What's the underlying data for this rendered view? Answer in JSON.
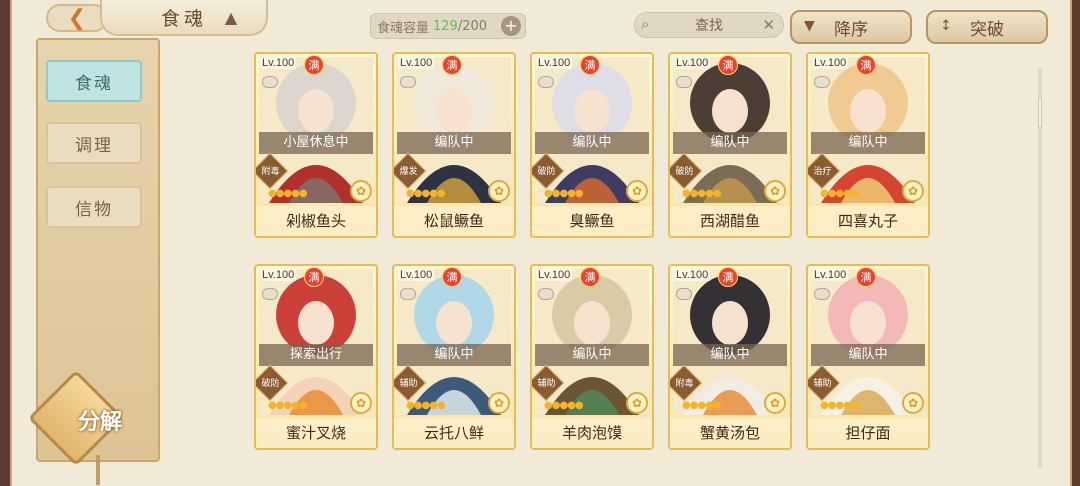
{
  "header": {
    "back_icon": "back-arrow-icon",
    "title": "食魂",
    "capacity_label": "食魂容量",
    "capacity_current": "129",
    "capacity_max": "/200",
    "plus_icon": "plus-icon",
    "search_placeholder": "查找",
    "sort_label": "降序",
    "breakthrough_label": "突破"
  },
  "sidebar": {
    "items": [
      {
        "label": "食魂",
        "active": true
      },
      {
        "label": "调理",
        "active": false
      },
      {
        "label": "信物",
        "active": false
      }
    ],
    "decompose_label": "分解"
  },
  "cards": [
    {
      "level": "Lv.100",
      "badge": "满",
      "status": "小屋休息中",
      "role": "附毒",
      "name": "剁椒鱼头",
      "rarity_color": "#e7bb55",
      "portrait_colors": [
        "#d9d4cf",
        "#b2302c",
        "#7b7672"
      ]
    },
    {
      "level": "Lv.100",
      "badge": "满",
      "status": "编队中",
      "role": "爆发",
      "name": "松鼠鳜鱼",
      "rarity_color": "#e7bb55",
      "portrait_colors": [
        "#efe8dd",
        "#2b3345",
        "#d7a53c"
      ]
    },
    {
      "level": "Lv.100",
      "badge": "满",
      "status": "编队中",
      "role": "破防",
      "name": "臭鳜鱼",
      "rarity_color": "#e7bb55",
      "portrait_colors": [
        "#dddbe8",
        "#3f3c63",
        "#d96a2d"
      ]
    },
    {
      "level": "Lv.100",
      "badge": "满",
      "status": "编队中",
      "role": "破防",
      "name": "西湖醋鱼",
      "rarity_color": "#e7bb55",
      "portrait_colors": [
        "#3a2b23",
        "#7a6c55",
        "#c79a4e"
      ]
    },
    {
      "level": "Lv.100",
      "badge": "满",
      "status": "编队中",
      "role": "治疗",
      "name": "四喜丸子",
      "rarity_color": "#e7bb55",
      "portrait_colors": [
        "#f0c68a",
        "#d4442f",
        "#f2d47a"
      ]
    },
    {
      "level": "Lv.100",
      "badge": "满",
      "status": "探索出行",
      "role": "破防",
      "name": "蜜汁叉烧",
      "rarity_color": "#e7bb55",
      "portrait_colors": [
        "#c72e28",
        "#f5d3b8",
        "#e58a2b"
      ]
    },
    {
      "level": "Lv.100",
      "badge": "满",
      "status": "编队中",
      "role": "辅助",
      "name": "云托八鲜",
      "rarity_color": "#e7bb55",
      "portrait_colors": [
        "#a9d6ea",
        "#3d5a7a",
        "#e9f2f5"
      ]
    },
    {
      "level": "Lv.100",
      "badge": "满",
      "status": "编队中",
      "role": "辅助",
      "name": "羊肉泡馍",
      "rarity_color": "#e7bb55",
      "portrait_colors": [
        "#d8c6a2",
        "#6b5534",
        "#4f8a5a"
      ]
    },
    {
      "level": "Lv.100",
      "badge": "满",
      "status": "编队中",
      "role": "附毒",
      "name": "蟹黄汤包",
      "rarity_color": "#e7bb55",
      "portrait_colors": [
        "#1e1d24",
        "#f2ede4",
        "#e38a2f"
      ]
    },
    {
      "level": "Lv.100",
      "badge": "满",
      "status": "编队中",
      "role": "辅助",
      "name": "担仔面",
      "rarity_color": "#e7bb55",
      "portrait_colors": [
        "#f3b2b6",
        "#f7f1e4",
        "#d6a84c"
      ]
    }
  ]
}
